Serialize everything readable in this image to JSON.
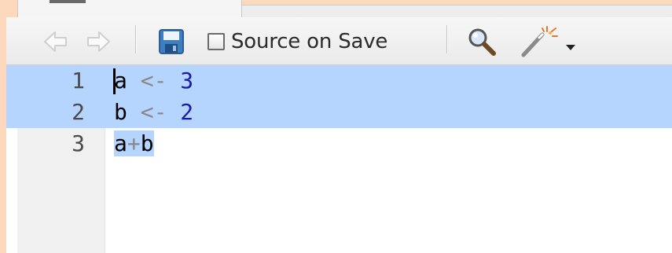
{
  "toolbar": {
    "back_icon": "back-arrow-icon",
    "forward_icon": "forward-arrow-icon",
    "save_icon": "floppy-disk-icon",
    "source_on_save_label": "Source on Save",
    "source_on_save_checked": false,
    "find_icon": "magnifier-icon",
    "code_tools_icon": "magic-wand-icon",
    "dropdown_icon": "caret-down-icon"
  },
  "editor": {
    "lines": [
      {
        "number": "1",
        "tokens": [
          {
            "text": "a",
            "type": "id"
          },
          {
            "text": " <- ",
            "type": "op"
          },
          {
            "text": "3",
            "type": "num"
          }
        ],
        "selected": true
      },
      {
        "number": "2",
        "tokens": [
          {
            "text": "b",
            "type": "id"
          },
          {
            "text": " <- ",
            "type": "op"
          },
          {
            "text": "2",
            "type": "num"
          }
        ],
        "selected": true
      },
      {
        "number": "3",
        "tokens": [
          {
            "text": "a",
            "type": "id"
          },
          {
            "text": "+",
            "type": "op"
          },
          {
            "text": "b",
            "type": "id"
          }
        ],
        "selected": false
      }
    ],
    "selection_color": "#b5d5ff"
  },
  "colors": {
    "frame_accent": "#fcd9bd",
    "number_literal": "#1a1aa6",
    "operator": "#888888"
  }
}
